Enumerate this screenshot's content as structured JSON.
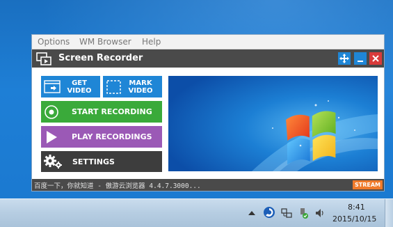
{
  "menu": {
    "items": [
      "Options",
      "WM Browser",
      "Help"
    ]
  },
  "window": {
    "title": "Screen Recorder"
  },
  "buttons": {
    "get_video_line1": "GET",
    "get_video_line2": "VIDEO",
    "mark_video_line1": "MARK",
    "mark_video_line2": "VIDEO",
    "start_recording": "START RECORDING",
    "play_recordings": "PLAY RECORDINGS",
    "settings": "SETTINGS"
  },
  "status": {
    "text": "百度一下，你就知道 - 傲游云浏览器 4.4.7.3000...",
    "stream_badge": "STREAM"
  },
  "taskbar": {
    "time": "8:41",
    "date": "2015/10/15"
  },
  "colors": {
    "accent_blue": "#1f86d6",
    "green": "#3aaa3a",
    "purple": "#9b59b6",
    "dark": "#3d3d3d",
    "close_red": "#d93b3b",
    "titlebar": "#4a4a4a"
  },
  "icons": {
    "move": "move-icon",
    "minimize": "minimize-icon",
    "close": "close-icon",
    "get_video": "screen-capture-icon",
    "mark_video": "dashed-square-icon",
    "start_recording": "record-icon",
    "play_recordings": "play-icon",
    "settings": "gear-icon"
  }
}
